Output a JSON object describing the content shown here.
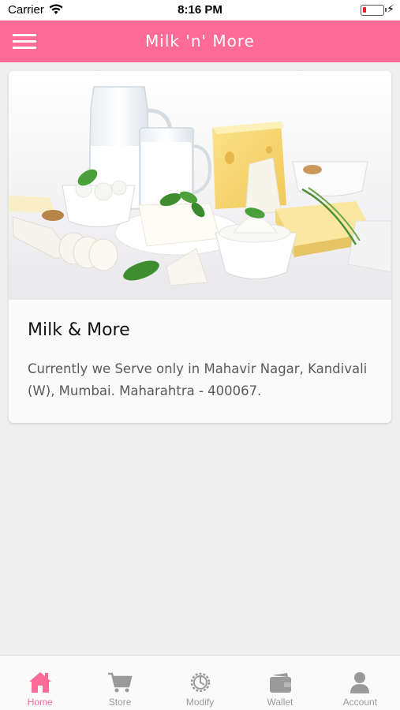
{
  "status_bar": {
    "carrier": "Carrier",
    "time": "8:16 PM"
  },
  "header": {
    "title": "Milk 'n' More",
    "accent_color": "#ff6b99"
  },
  "card": {
    "image_icon": "dairy-products-photo",
    "title": "Milk & More",
    "description": "Currently we Serve only in Mahavir Nagar, Kandivali (W), Mumbai. Maharahtra - 400067."
  },
  "tabs": [
    {
      "label": "Home",
      "icon": "home-icon",
      "active": true
    },
    {
      "label": "Store",
      "icon": "cart-icon",
      "active": false
    },
    {
      "label": "Modify",
      "icon": "settings-icon",
      "active": false
    },
    {
      "label": "Wallet",
      "icon": "wallet-icon",
      "active": false
    },
    {
      "label": "Account",
      "icon": "account-icon",
      "active": false
    }
  ]
}
